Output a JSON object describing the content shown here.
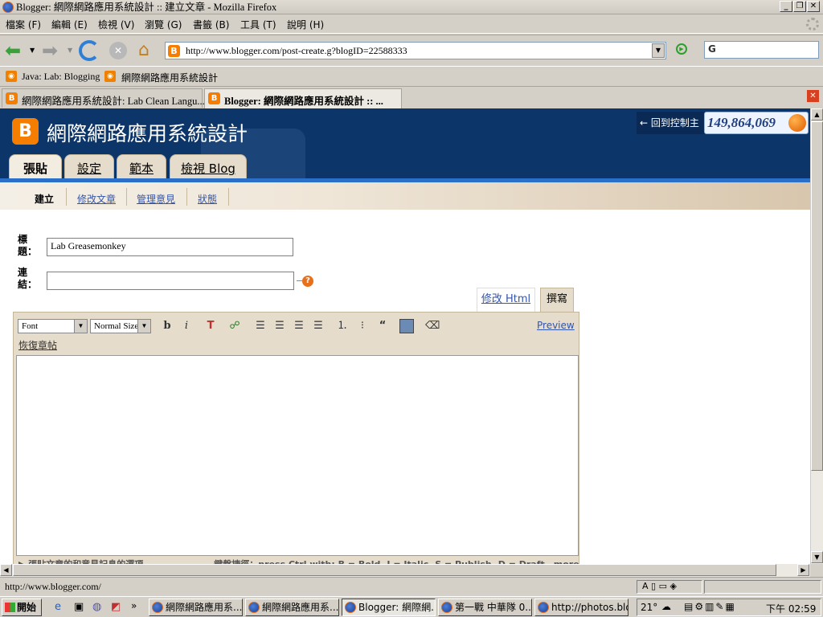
{
  "window": {
    "title": "Blogger: 網際網路應用系統設計 :: 建立文章 - Mozilla Firefox"
  },
  "menu": [
    "檔案 (F)",
    "編輯 (E)",
    "檢視 (V)",
    "瀏覽 (G)",
    "書籤 (B)",
    "工具 (T)",
    "說明 (H)"
  ],
  "address": {
    "url": "http://www.blogger.com/post-create.g?blogID=22588333"
  },
  "search": {
    "engine_glyph": "G"
  },
  "bookmarks": [
    "Java: Lab: Blogging",
    "網際網路應用系統設計"
  ],
  "tabs": [
    "網際網路應用系統設計: Lab Clean Langu...",
    "Blogger: 網際網路應用系統設計 :: ..."
  ],
  "blog": {
    "title": "網際網路應用系統設計",
    "back_link": "← 回到控制主",
    "counter": "149,864,069",
    "main_tabs": [
      "張貼",
      "設定",
      "範本",
      "檢視 Blog"
    ],
    "subnav": [
      "建立",
      "修改文章",
      "管理意見",
      "狀態"
    ]
  },
  "form": {
    "title_label": "標題：",
    "title_value": "Lab Greasemonkey",
    "link_label": "連結：",
    "link_value": "",
    "help_glyph": "?"
  },
  "editor": {
    "mode_tabs": [
      "修改 Html",
      "撰寫"
    ],
    "font_select": "Font",
    "size_select": "Normal Size",
    "preview": "Preview",
    "restore": "恢復章帖",
    "bottom_text": "▶ 張貼文章的和意見記息的選項　　　　　　　　鍵盤捷徑：press Ctrl with: B = Bold, I = Italic, S = Publish, D = Draft　more"
  },
  "status": {
    "text": "http://www.blogger.com/"
  },
  "taskbar": {
    "start": "開始",
    "tasks": [
      "網際網路應用系...",
      "網際網路應用系...",
      "Blogger: 網際網...",
      "第一戰 中華隊 0...",
      "http://photos.blog..."
    ],
    "temp": "21°",
    "clock": "下午 02:59"
  }
}
